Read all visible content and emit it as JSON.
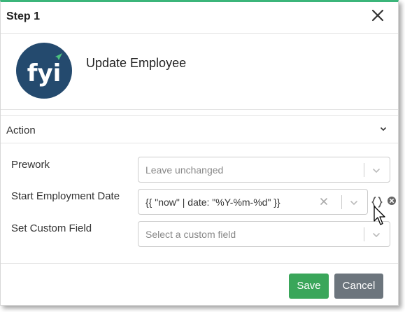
{
  "dialog": {
    "title": "Step 1",
    "close_icon": "close-icon"
  },
  "hero": {
    "logo_text": "fyi",
    "name": "Update Employee"
  },
  "section": {
    "label": "Action"
  },
  "fields": [
    {
      "label": "Prework",
      "placeholder": "Leave unchanged"
    },
    {
      "label": "Start Employment Date",
      "value": "{{ \"now\" | date: \"%Y-%m-%d\" }}"
    },
    {
      "label": "Set Custom Field",
      "placeholder": "Select a custom field"
    }
  ],
  "buttons": {
    "save": "Save",
    "cancel": "Cancel"
  },
  "colors": {
    "accent": "#3bb57a",
    "logo_bg": "#244a6e",
    "save": "#3aa65a",
    "cancel": "#6c757d"
  }
}
